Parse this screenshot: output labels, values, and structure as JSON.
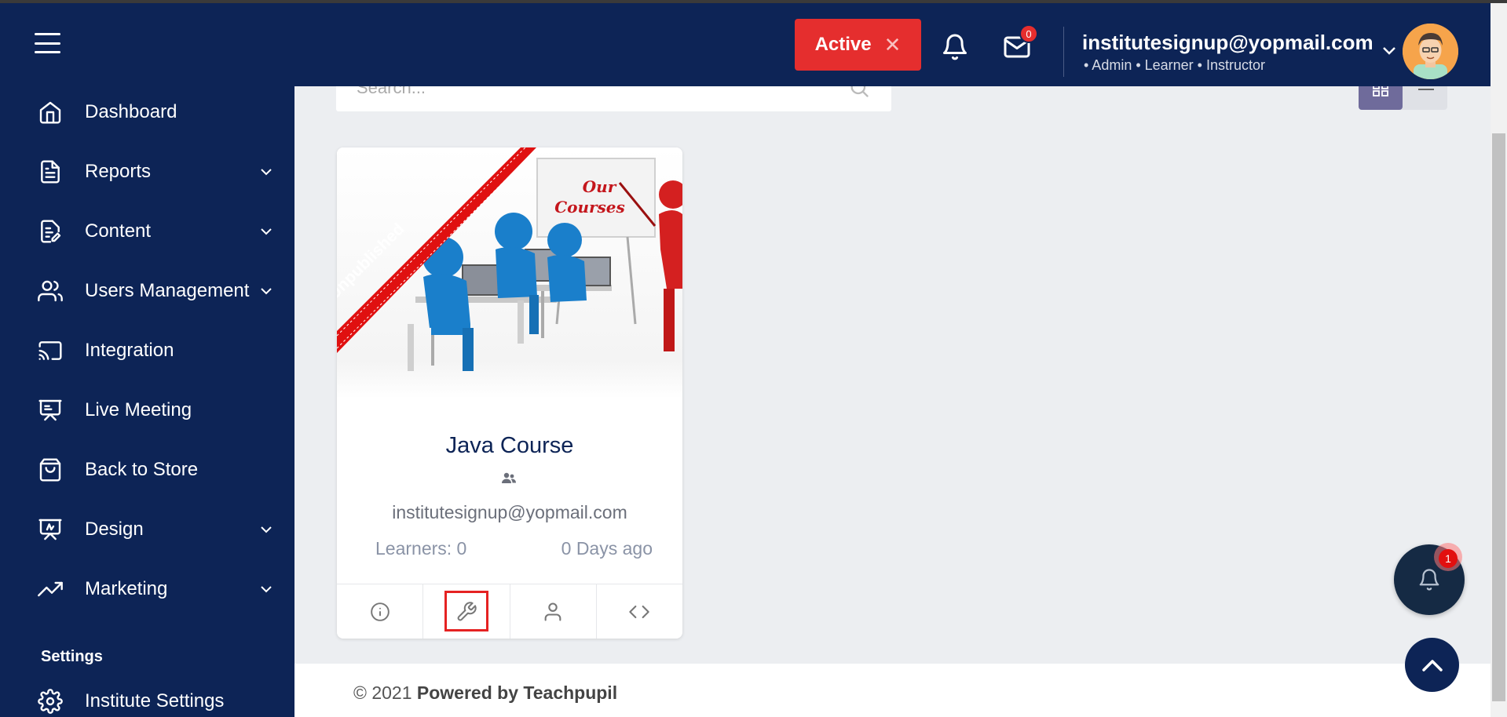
{
  "header": {
    "status_button": "Active",
    "mail_badge": "0",
    "user_email": "institutesignup@yopmail.com",
    "user_roles": "• Admin • Learner • Instructor"
  },
  "sidebar": {
    "items": [
      {
        "label": "Dashboard",
        "icon": "home-icon"
      },
      {
        "label": "Reports",
        "icon": "document-icon"
      },
      {
        "label": "Content",
        "icon": "content-icon"
      },
      {
        "label": "Users Management",
        "icon": "users-icon"
      },
      {
        "label": "Integration",
        "icon": "cast-icon"
      },
      {
        "label": "Live Meeting",
        "icon": "presentation-icon"
      },
      {
        "label": "Back to Store",
        "icon": "shopping-bag-icon"
      },
      {
        "label": "Design",
        "icon": "design-icon"
      },
      {
        "label": "Marketing",
        "icon": "trending-up-icon"
      }
    ],
    "settings_heading": "Settings",
    "settings_items": [
      {
        "label": "Institute Settings",
        "icon": "gear-icon"
      }
    ]
  },
  "main": {
    "search_placeholder": "Search..."
  },
  "course_card": {
    "ribbon": "Unpublished",
    "image_text_line1": "Our",
    "image_text_line2": "Courses",
    "title": "Java Course",
    "author": "institutesignup@yopmail.com",
    "learners": "Learners: 0",
    "age": "0 Days ago"
  },
  "footer": {
    "copyright": "© 2021",
    "powered": "Powered by Teachpupil"
  },
  "floating": {
    "notification_count": "1"
  },
  "colors": {
    "navy": "#0d2456",
    "accent_red": "#e52e2e",
    "background": "#eceef1"
  }
}
